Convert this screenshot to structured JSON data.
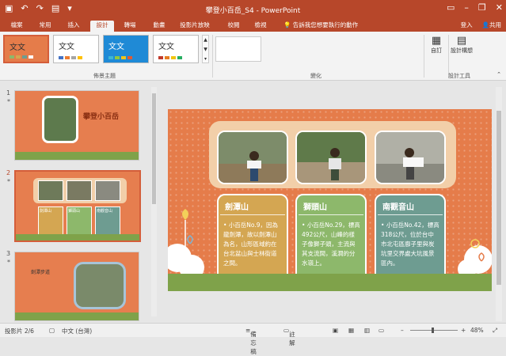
{
  "titlebar": {
    "title": "攀登小百岳_S4 - PowerPoint",
    "qat": [
      "save-icon",
      "undo-icon",
      "redo-icon",
      "start-from-beginning-icon"
    ],
    "window_controls": [
      "ribbon-display-icon",
      "minimize-icon",
      "restore-icon",
      "close-icon"
    ]
  },
  "tabs": [
    "檔案",
    "常用",
    "插入",
    "設計",
    "轉場",
    "動畫",
    "投影片放映",
    "校閱",
    "檢視"
  ],
  "active_tab": "設計",
  "tellme": "告訴我您想要執行的動作",
  "user": {
    "signin": "登入",
    "share": "共用"
  },
  "ribbon": {
    "theme_thumb_text": "文文",
    "group_themes": "佈景主題",
    "group_variants": "變化",
    "group_customize": "自訂",
    "group_designer": "設計工具",
    "customize_label": "自訂",
    "designer_label": "設計構想"
  },
  "slides": {
    "numbers": [
      "1",
      "2",
      "3"
    ],
    "stars": [
      "*",
      "*",
      "*"
    ],
    "slide1_title": "攀登小百岳",
    "slide2_heads": [
      "劍潭山",
      "獅頭山",
      "南觀音山"
    ],
    "slide3_title": "劍潭步道"
  },
  "slide": {
    "cards": [
      {
        "title": "劍潭山",
        "body": "小百岳No.9，因為龍劍潭，故以劍潭山為名，山形區域約在台北盆山與士林街道之間。",
        "color": "#d4a652"
      },
      {
        "title": "獅頭山",
        "body": "小百岳No.29，標高492公尺，山峰的樣子像獅子頭，主流與其支流間，溪澗的分水嶺上。",
        "color": "#8db86b"
      },
      {
        "title": "南觀音山",
        "body": "小百岳No.42，標高318公尺，位於台中市北屯區廍子里與炭坑里交界處大坑風景區內。",
        "color": "#6e9c91"
      }
    ]
  },
  "status": {
    "slide_info": "投影片 2/6",
    "language": "中文 (台灣)",
    "notes": "備忘稿",
    "comments": "註解",
    "zoom": "48%"
  },
  "colors": {
    "accent": "#b7472a",
    "slide_bg": "#e57c4a",
    "frame": "#f2cfa9"
  }
}
